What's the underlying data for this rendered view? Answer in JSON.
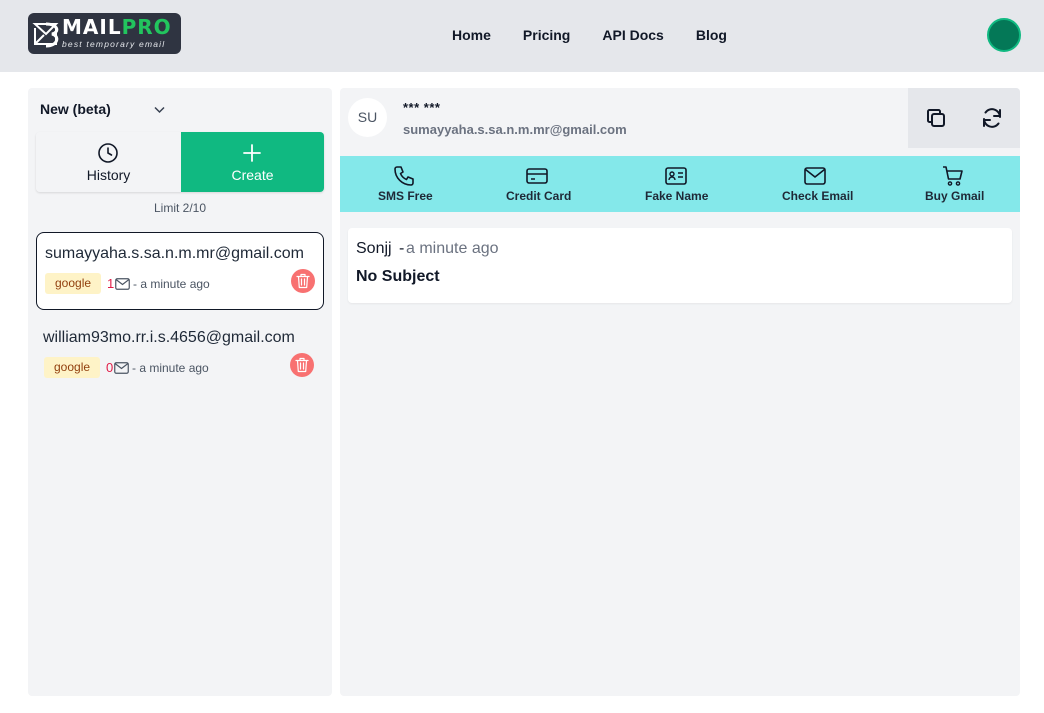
{
  "header": {
    "logo": {
      "brand_main": "MAIL",
      "brand_accent": "PRO",
      "tagline": "best temporary email"
    },
    "nav": [
      "Home",
      "Pricing",
      "API Docs",
      "Blog"
    ]
  },
  "sidebar": {
    "version_label": "New (beta)",
    "history_label": "History",
    "create_label": "Create",
    "limit_text": "Limit 2/10",
    "emails": [
      {
        "address": "sumayyaha.s.sa.n.m.mr@gmail.com",
        "tag": "google",
        "count": "1",
        "time": "- a minute ago"
      },
      {
        "address": "william93mo.rr.i.s.4656@gmail.com",
        "tag": "google",
        "count": "0",
        "time": "- a minute ago"
      }
    ]
  },
  "main": {
    "initials": "SU",
    "masked_name": "*** ***",
    "active_address": "sumayyaha.s.sa.n.m.mr@gmail.com",
    "tools": [
      "SMS Free",
      "Credit Card",
      "Fake Name",
      "Check Email",
      "Buy Gmail"
    ],
    "message": {
      "from": "Sonjj",
      "separator": "-",
      "time": "a minute ago",
      "subject": "No Subject"
    }
  },
  "colors": {
    "accent_green": "#10b981",
    "toolbar_bg": "#84e8ea",
    "tag_bg": "#fef3c7",
    "delete_red": "#f87171",
    "avatar_green": "#047857"
  }
}
